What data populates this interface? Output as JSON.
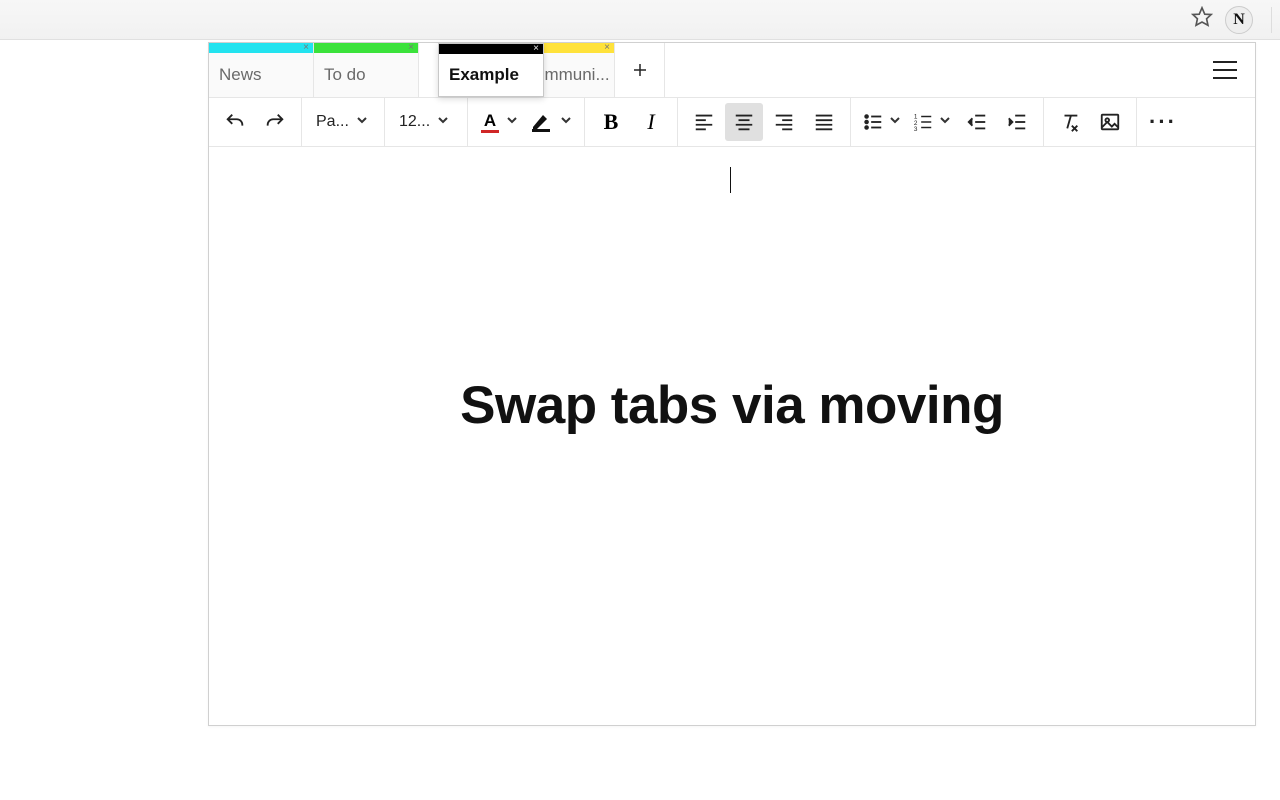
{
  "browser": {
    "ext_badge": "N"
  },
  "tabs": [
    {
      "label": "News",
      "color": "#22e3ef",
      "active": false
    },
    {
      "label": "To do",
      "color": "#3be23b",
      "active": false
    },
    {
      "label": "Example",
      "color": "#000000",
      "active": true
    },
    {
      "label": "ommuni...",
      "color": "#ffe23b",
      "active": false
    }
  ],
  "toolbar": {
    "style_select": "Pa...",
    "size_select": "12...",
    "align_active": "center"
  },
  "document": {
    "heading": "Swap tabs via moving"
  }
}
